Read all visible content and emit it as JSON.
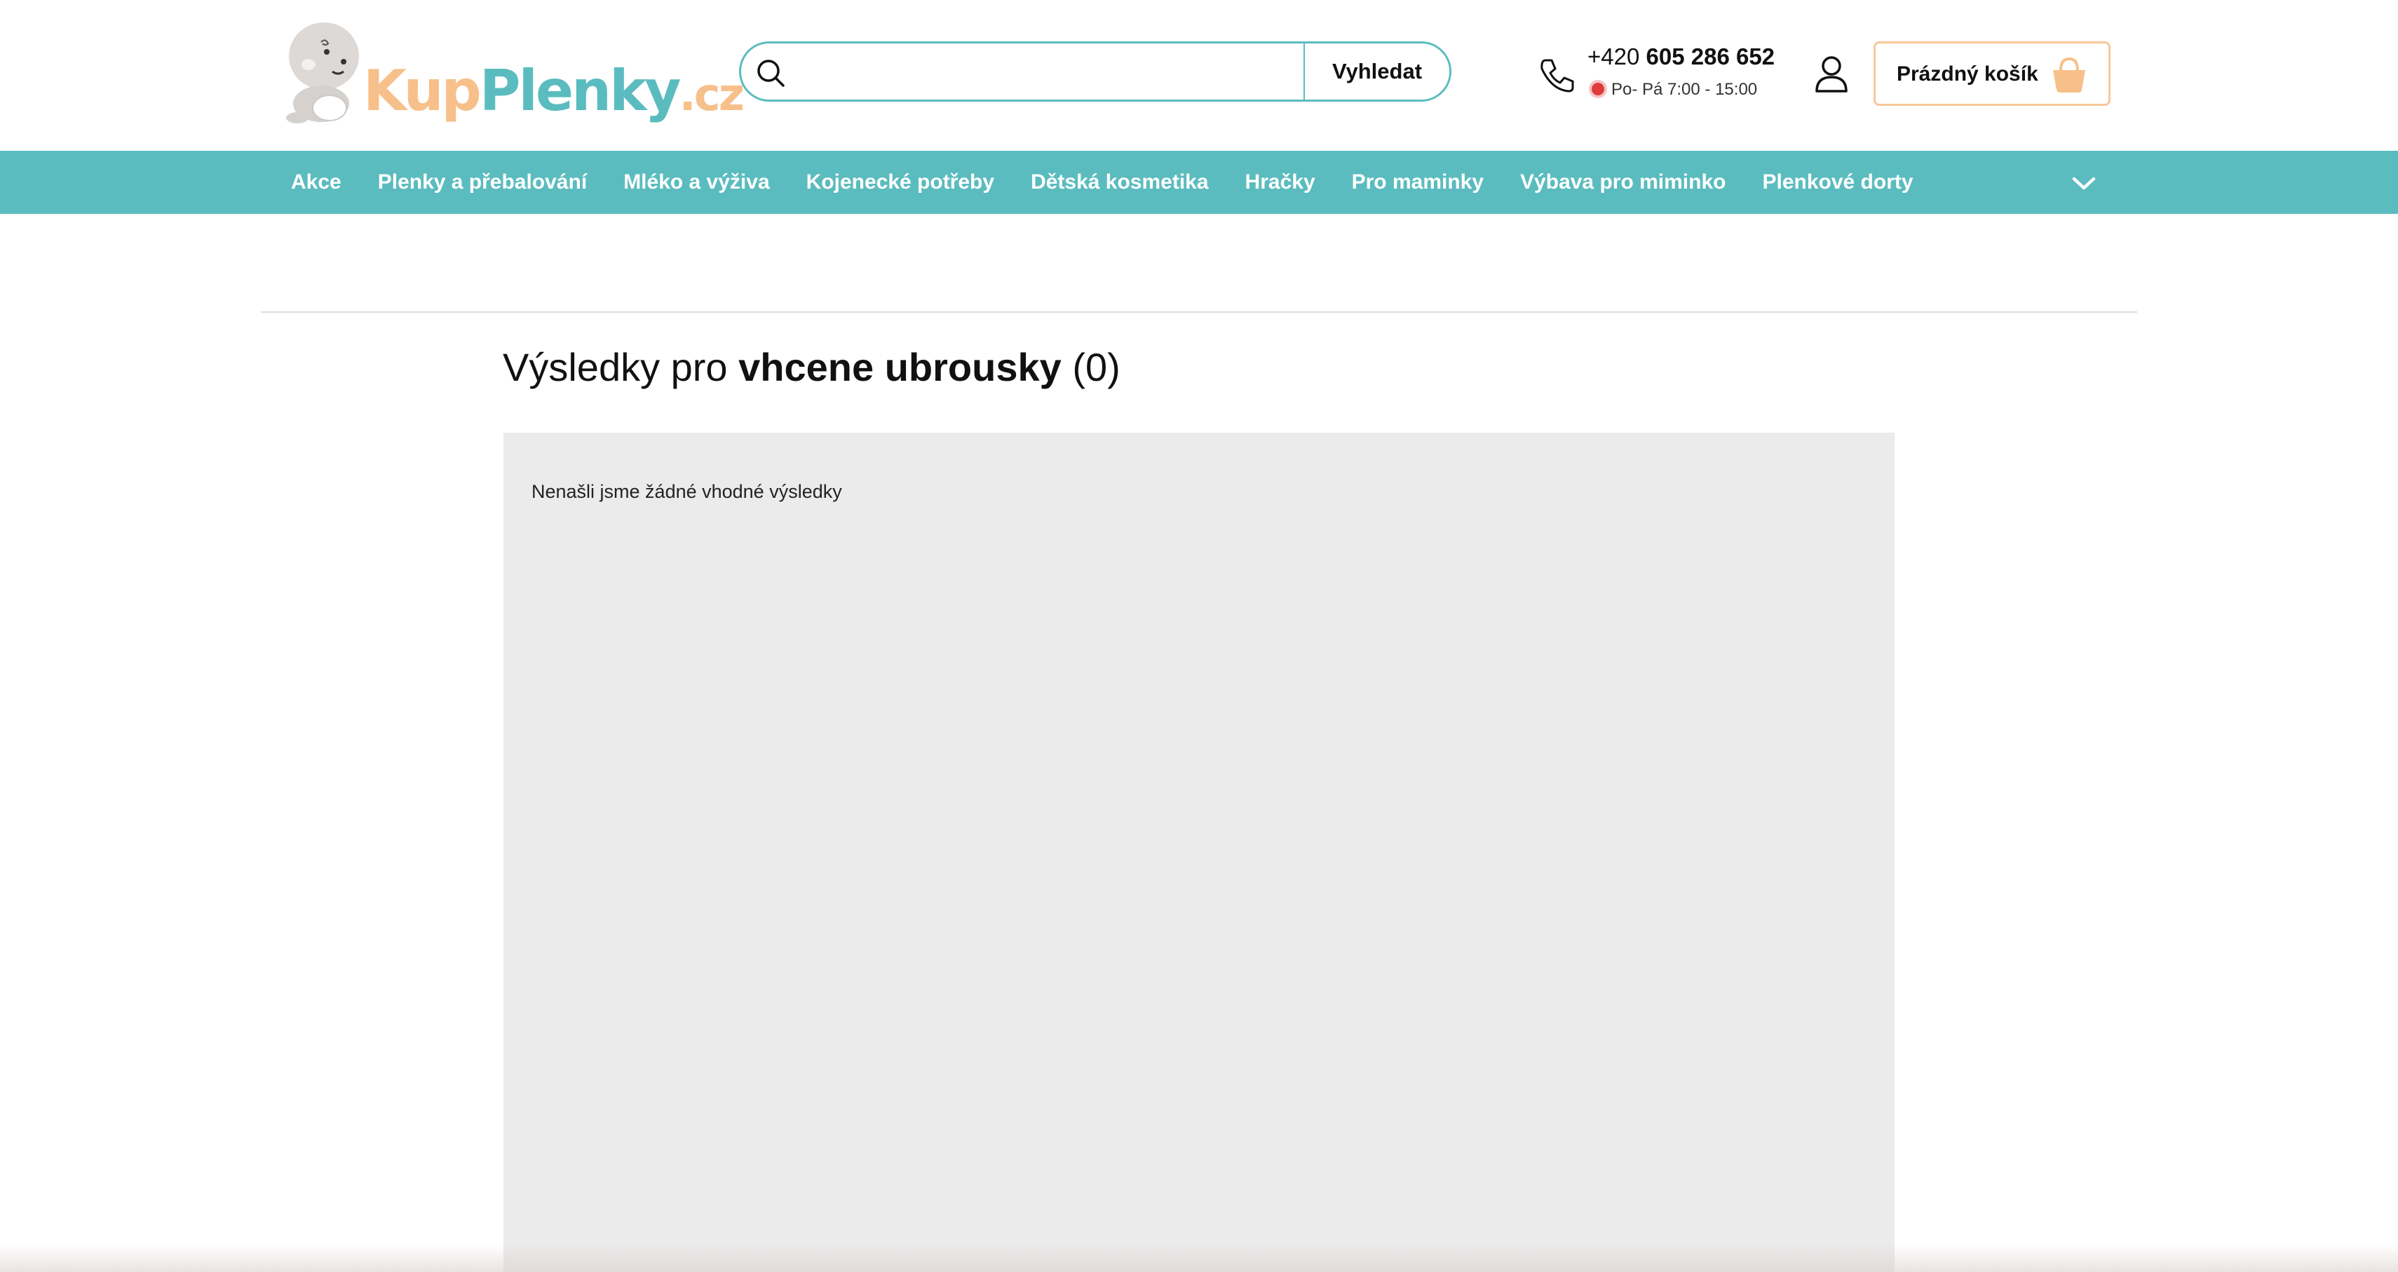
{
  "logo": {
    "part1": "Kup",
    "part2": "Plenky",
    "part3": ".cz",
    "colors": {
      "kup": "#f7c08a",
      "plenky": "#5bbcbf",
      "cz": "#f7c08a"
    }
  },
  "search": {
    "value": "",
    "placeholder": "",
    "button_label": "Vyhledat",
    "icon": "search-icon"
  },
  "contact": {
    "phone_prefix": "+420",
    "phone_number": "605 286 652",
    "hours": "Po- Pá 7:00 - 15:00",
    "status_color": "#e03b3b",
    "icon": "phone-icon"
  },
  "account": {
    "icon": "user-icon"
  },
  "cart": {
    "label": "Prázdný košík",
    "icon": "shopping-basket-icon"
  },
  "nav": {
    "items": [
      {
        "label": "Akce"
      },
      {
        "label": "Plenky a přebalování"
      },
      {
        "label": "Mléko a výživa"
      },
      {
        "label": "Kojenecké potřeby"
      },
      {
        "label": "Dětská kosmetika"
      },
      {
        "label": "Hračky"
      },
      {
        "label": "Pro maminky"
      },
      {
        "label": "Výbava pro miminko"
      },
      {
        "label": "Plenkové dorty"
      }
    ],
    "more_icon": "chevron-down-icon"
  },
  "results": {
    "prefix": "Výsledky pro",
    "query": "vhcene ubrousky",
    "count": "(0)",
    "empty_message": "Nenašli jsme žádné vhodné výsledky"
  },
  "colors": {
    "accent": "#5bbcbf",
    "brand_orange": "#f7c08a",
    "panel_background": "#ebebeb"
  }
}
